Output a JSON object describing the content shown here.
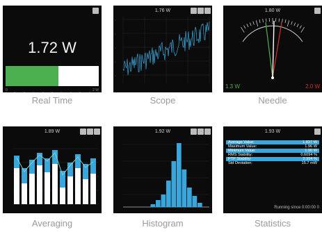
{
  "tiles": [
    {
      "label": "Real Time"
    },
    {
      "label": "Scope"
    },
    {
      "label": "Needle"
    },
    {
      "label": "Averaging"
    },
    {
      "label": "Histogram"
    },
    {
      "label": "Statistics"
    }
  ],
  "realtime": {
    "value": "1.72 W",
    "fill": 0.57,
    "tick_left": "0",
    "tick_right": "2 W"
  },
  "scope": {
    "title": "1.76 W"
  },
  "needle": {
    "title": "1.80 W",
    "min": "1.3 W",
    "max": "2.0 W"
  },
  "averaging": {
    "title": "1.89 W"
  },
  "histogram": {
    "title": "1.92 W"
  },
  "statistics": {
    "title": "1.93 W",
    "rows": [
      {
        "k": "Average Value:",
        "v": "1.837 W"
      },
      {
        "k": "Maximum Value:",
        "v": "1.96 W"
      },
      {
        "k": "Minimum Value:",
        "v": "1.90 W"
      },
      {
        "k": "RMS Stability:",
        "v": "0.6094 %"
      },
      {
        "k": "PTP Stability:",
        "v": "2.994 %"
      },
      {
        "k": "Std Deviation:",
        "v": "15.7 mW"
      }
    ],
    "footer": "Running since 0:00:00 0"
  },
  "colors": {
    "accent": "#3aa7dc",
    "green": "#4caf50",
    "red": "#d32f2f",
    "panel": "#0b0b0b"
  }
}
